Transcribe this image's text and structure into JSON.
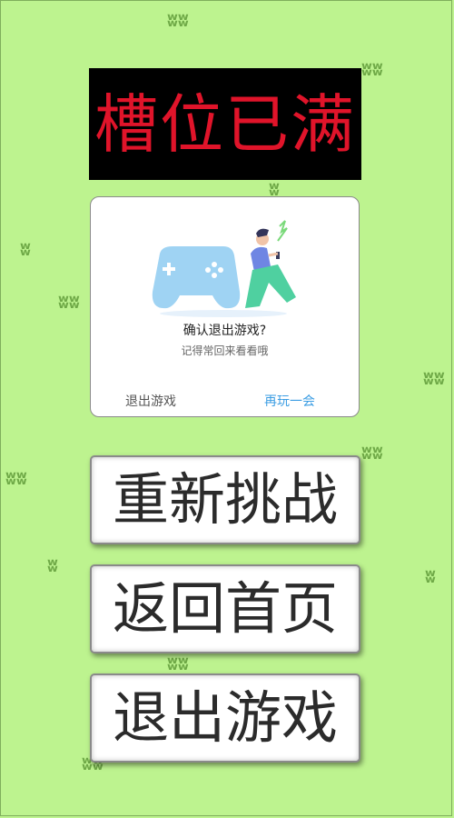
{
  "banner": {
    "text": "槽位已满"
  },
  "dialog": {
    "title": "确认退出游戏?",
    "subtitle": "记得常回来看看哦",
    "exit_label": "退出游戏",
    "replay_label": "再玩一会"
  },
  "menu": {
    "restart_label": "重新挑战",
    "home_label": "返回首页",
    "exit_label": "退出游戏"
  },
  "colors": {
    "background": "#bdf38f",
    "banner_text": "#e0142a",
    "accent": "#3b9de3"
  },
  "icons": {
    "grass": "grass-tuft-icon",
    "illustration": "gamepad-person-illustration"
  }
}
